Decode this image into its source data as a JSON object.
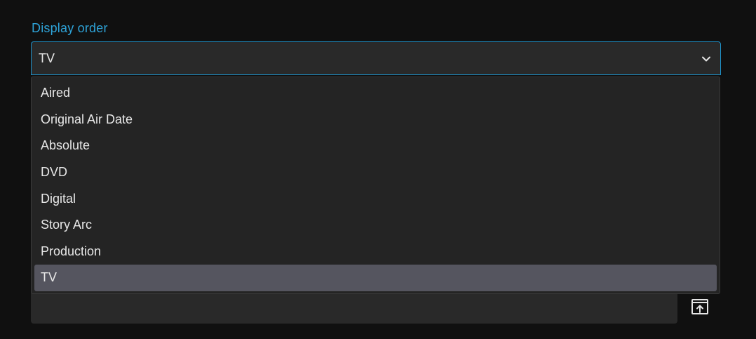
{
  "field": {
    "label": "Display order",
    "value": "TV"
  },
  "dropdown": {
    "options": [
      {
        "label": "Aired",
        "selected": false
      },
      {
        "label": "Original Air Date",
        "selected": false
      },
      {
        "label": "Absolute",
        "selected": false
      },
      {
        "label": "DVD",
        "selected": false
      },
      {
        "label": "Digital",
        "selected": false
      },
      {
        "label": "Story Arc",
        "selected": false
      },
      {
        "label": "Production",
        "selected": false
      },
      {
        "label": "TV",
        "selected": true
      }
    ]
  },
  "icons": {
    "dropdown_arrow": "chevron-down-icon",
    "open_external": "open-in-new-icon"
  },
  "colors": {
    "accent": "#2ea3d8",
    "background": "#101010",
    "field_bg": "#292929",
    "selected_option_bg": "#55555f"
  }
}
